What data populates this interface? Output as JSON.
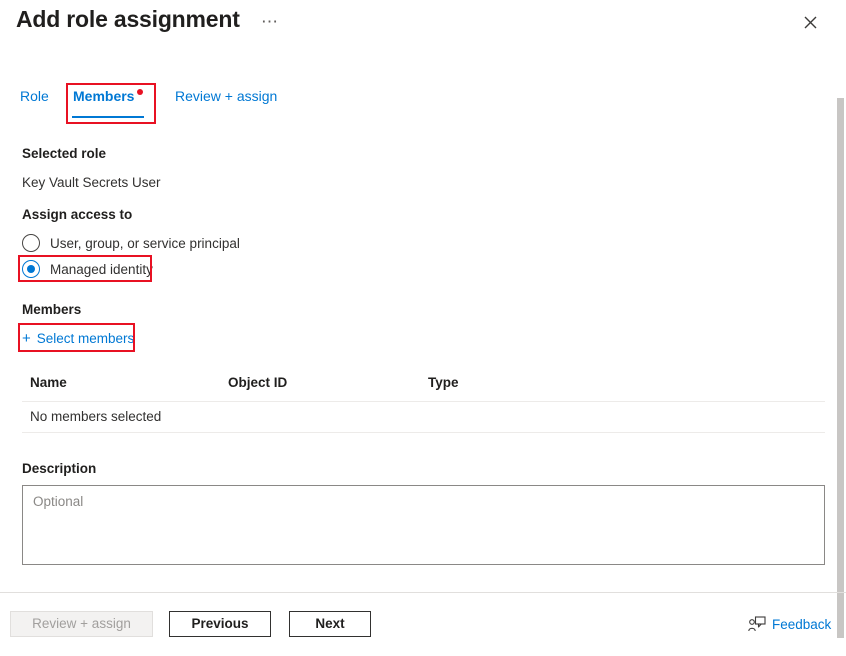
{
  "header": {
    "title": "Add role assignment",
    "ellipsis_label": "⋯",
    "close_icon": "close-icon"
  },
  "tabs": [
    {
      "id": "role",
      "label": "Role",
      "selected": false
    },
    {
      "id": "members",
      "label": "Members",
      "selected": true
    },
    {
      "id": "review",
      "label": "Review + assign",
      "selected": false
    }
  ],
  "form": {
    "selected_role_label": "Selected role",
    "selected_role_value": "Key Vault Secrets User",
    "assign_access_label": "Assign access to",
    "assign_access_options": [
      {
        "label": "User, group, or service principal",
        "checked": false
      },
      {
        "label": "Managed identity",
        "checked": true
      }
    ],
    "members_label": "Members",
    "select_members_link": "Select members",
    "plus_icon": "plus-icon",
    "description_label": "Description",
    "description_value": "",
    "description_placeholder": "Optional"
  },
  "members_table": {
    "columns": [
      "Name",
      "Object ID",
      "Type"
    ],
    "rows": [
      {
        "name": "No members selected",
        "object_id": "",
        "type": ""
      }
    ]
  },
  "footer": {
    "review_assign_button": "Review + assign",
    "previous_button": "Previous",
    "next_button": "Next",
    "feedback_label": "Feedback",
    "feedback_icon": "feedback-person-icon"
  },
  "colors": {
    "accent_blue": "#0078d4",
    "highlight_red": "#e81123",
    "text_primary": "#201f1e",
    "text_secondary": "#323130",
    "placeholder": "#8a8886",
    "divider": "#edebe9",
    "scrollbar_thumb": "#c8c6c4"
  }
}
